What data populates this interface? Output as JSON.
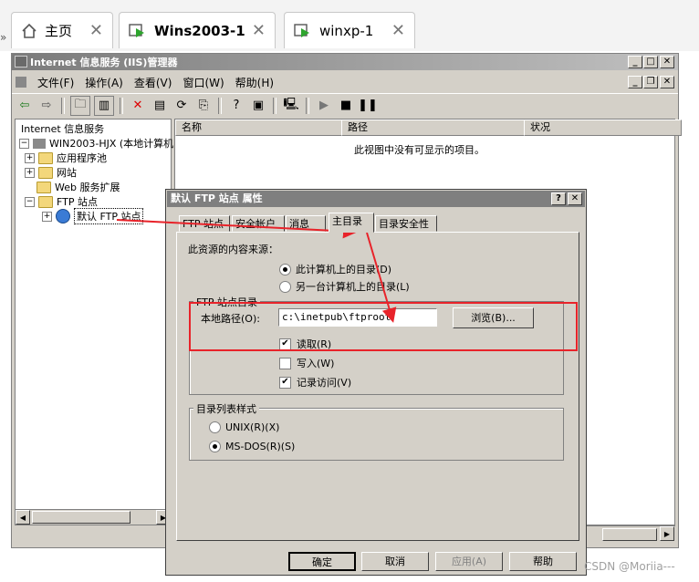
{
  "browser_tabs": [
    {
      "label": "主页",
      "icon": "home-icon"
    },
    {
      "label": "Wins2003-1",
      "icon": "vm-play-icon",
      "active": true
    },
    {
      "label": "winxp-1",
      "icon": "vm-play-icon"
    }
  ],
  "window": {
    "title": "Internet 信息服务 (IIS)管理器",
    "menu": [
      "文件(F)",
      "操作(A)",
      "查看(V)",
      "窗口(W)",
      "帮助(H)"
    ]
  },
  "tree": {
    "root": "Internet 信息服务",
    "computer": "WIN2003-HJX (本地计算机)",
    "items": [
      "应用程序池",
      "网站",
      "Web 服务扩展",
      "FTP 站点"
    ],
    "selected": "默认 FTP 站点"
  },
  "list": {
    "columns": [
      "名称",
      "路径",
      "状况"
    ],
    "empty_message": "此视图中没有可显示的项目。"
  },
  "dialog": {
    "title": "默认 FTP 站点 属性",
    "tabs": [
      "FTP 站点",
      "安全帐户",
      "消息",
      "主目录",
      "目录安全性"
    ],
    "active_tab": "主目录",
    "source_label": "此资源的内容来源：",
    "source_options": [
      "此计算机上的目录(D)",
      "另一台计算机上的目录(L)"
    ],
    "ftp_dir_group": "FTP 站点目录",
    "local_path_label": "本地路径(O):",
    "local_path_value": "c:\\inetpub\\ftproot",
    "browse_label": "浏览(B)...",
    "checkboxes": [
      {
        "label": "读取(R)",
        "checked": true
      },
      {
        "label": "写入(W)",
        "checked": false
      },
      {
        "label": "记录访问(V)",
        "checked": true
      }
    ],
    "listing_group": "目录列表样式",
    "listing_options": [
      "UNIX(R)(X)",
      "MS-DOS(R)(S)"
    ],
    "listing_selected": 1,
    "buttons": {
      "ok": "确定",
      "cancel": "取消",
      "apply": "应用(A)",
      "help": "帮助"
    }
  },
  "watermark": "CSDN @Moriia---",
  "colors": {
    "highlight": "#e8232a"
  }
}
